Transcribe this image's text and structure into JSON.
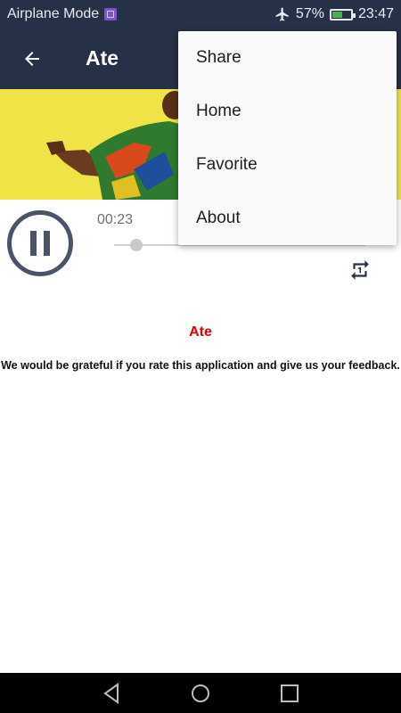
{
  "status_bar": {
    "left_text": "Airplane Mode",
    "battery_text": "57%",
    "battery_level": 0.57,
    "time": "23:47",
    "icons": [
      "sim-icon",
      "airplane-icon",
      "battery-charging-icon"
    ]
  },
  "app_bar": {
    "title": "Ate",
    "back_icon": "arrow-left-icon"
  },
  "player": {
    "elapsed": "00:23",
    "progress": 0.09,
    "state": "playing",
    "repeat_icon": "repeat-one-icon"
  },
  "content": {
    "song_title": "Ate",
    "feedback_text": "We would be grateful if you rate this application and give us your feedback."
  },
  "menu": {
    "items": [
      "Share",
      "Home",
      "Favorite",
      "About"
    ]
  },
  "nav_bar": {
    "icons": [
      "back-triangle-icon",
      "home-circle-icon",
      "recents-square-icon"
    ]
  },
  "colors": {
    "app_bar": "#263047",
    "banner": "#efe347",
    "title_red": "#e60000",
    "player_icon": "#4b5368"
  }
}
